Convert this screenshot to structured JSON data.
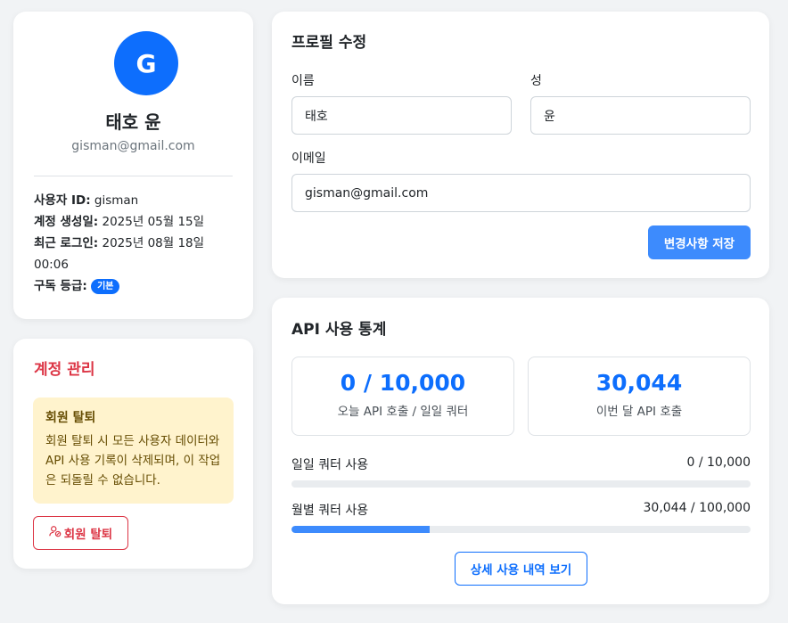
{
  "profile": {
    "avatar_letter": "G",
    "name": "태호 윤",
    "email": "gisman@gmail.com",
    "user_id_label": "사용자 ID:",
    "user_id": "gisman",
    "created_label": "계정 생성일:",
    "created": "2025년 05월 15일",
    "last_login_label": "최근 로그인:",
    "last_login": "2025년 08월 18일 00:06",
    "tier_label": "구독 등급:",
    "tier": "기본"
  },
  "account": {
    "title": "계정 관리",
    "warning_title": "회원 탈퇴",
    "warning_text": "회원 탈퇴 시 모든 사용자 데이터와 API 사용 기록이 삭제되며, 이 작업은 되돌릴 수 없습니다.",
    "delete_button": "회원 탈퇴",
    "delete_icon": "user-x-icon"
  },
  "edit_profile": {
    "title": "프로필 수정",
    "first_name_label": "이름",
    "first_name_value": "태호",
    "last_name_label": "성",
    "last_name_value": "윤",
    "email_label": "이메일",
    "email_value": "gisman@gmail.com",
    "save_button": "변경사항 저장"
  },
  "api_stats": {
    "title": "API 사용 통계",
    "today_value": "0 / 10,000",
    "today_label": "오늘 API 호출 / 일일 쿼터",
    "month_value": "30,044",
    "month_label": "이번 달 API 호출",
    "daily_quota_label": "일일 쿼터 사용",
    "daily_quota_value": "0 / 10,000",
    "daily_quota_fraction": 0.0,
    "monthly_quota_label": "월별 쿼터 사용",
    "monthly_quota_value": "30,044 / 100,000",
    "monthly_quota_fraction": 0.30044,
    "detail_button": "상세 사용 내역 보기"
  },
  "colors": {
    "primary": "#0d6efd",
    "primary_light": "#3d8bfd",
    "danger": "#dc3545",
    "warning_bg": "#fff3cd"
  }
}
